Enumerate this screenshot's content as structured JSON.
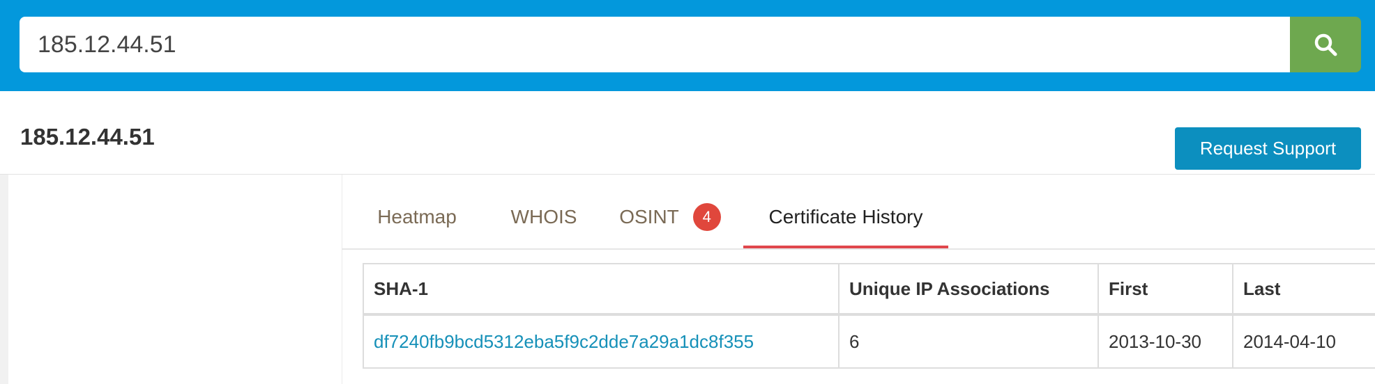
{
  "search": {
    "value": "185.12.44.51",
    "icon": "search-icon"
  },
  "header": {
    "title": "185.12.44.51",
    "support_label": "Request Support"
  },
  "tabs": [
    {
      "label": "Heatmap"
    },
    {
      "label": "WHOIS"
    },
    {
      "label": "OSINT",
      "badge": "4"
    },
    {
      "label": "Certificate History",
      "active": true
    }
  ],
  "table": {
    "columns": [
      "SHA-1",
      "Unique IP Associations",
      "First",
      "Last"
    ],
    "rows": [
      {
        "sha1": "df7240fb9bcd5312eba5f9c2dde7a29a1dc8f355",
        "unique_ip": "6",
        "first": "2013-10-30",
        "last": "2014-04-10"
      }
    ]
  },
  "colors": {
    "topbar": "#0398dc",
    "search_button": "#6ea84f",
    "support_button": "#0c8fbf",
    "active_tab_underline": "#e0474c",
    "badge": "#e0473c",
    "link": "#1590b8"
  }
}
